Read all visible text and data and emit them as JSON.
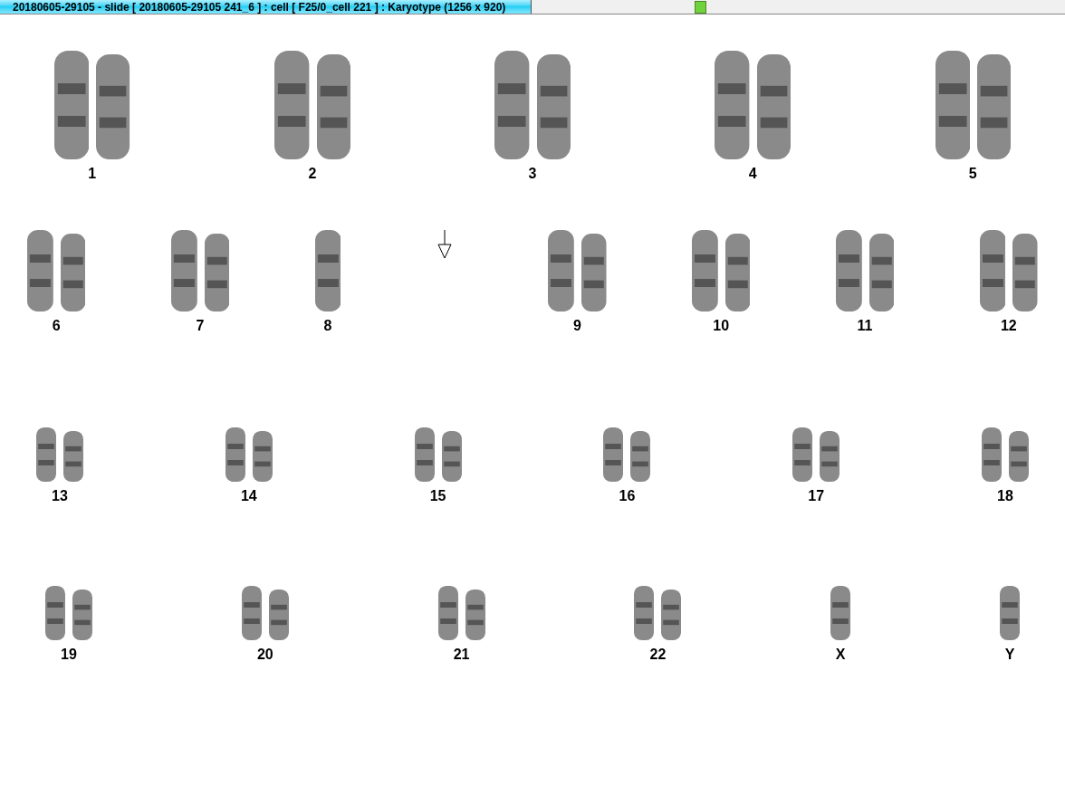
{
  "window": {
    "title": "20180605-29105 - slide [ 20180605-29105 241_6 ] : cell [ F25/0_cell 221 ] : Karyotype  (1256 x 920)"
  },
  "karyotype": {
    "rows": [
      [
        {
          "label": "1",
          "kind": "pair"
        },
        {
          "label": "2",
          "kind": "pair"
        },
        {
          "label": "3",
          "kind": "pair"
        },
        {
          "label": "4",
          "kind": "pair"
        },
        {
          "label": "5",
          "kind": "pair"
        }
      ],
      [
        {
          "label": "6",
          "kind": "pair"
        },
        {
          "label": "7",
          "kind": "pair"
        },
        {
          "label": "8",
          "kind": "single"
        },
        {
          "kind": "marker"
        },
        {
          "label": "9",
          "kind": "pair"
        },
        {
          "label": "10",
          "kind": "pair"
        },
        {
          "label": "11",
          "kind": "pair"
        },
        {
          "label": "12",
          "kind": "pair"
        }
      ],
      [
        {
          "label": "13",
          "kind": "pair"
        },
        {
          "label": "14",
          "kind": "pair"
        },
        {
          "label": "15",
          "kind": "pair"
        },
        {
          "label": "16",
          "kind": "pair"
        },
        {
          "label": "17",
          "kind": "pair"
        },
        {
          "label": "18",
          "kind": "pair"
        }
      ],
      [
        {
          "label": "19",
          "kind": "pair"
        },
        {
          "label": "20",
          "kind": "pair"
        },
        {
          "label": "21",
          "kind": "pair"
        },
        {
          "label": "22",
          "kind": "pair"
        },
        {
          "label": "X",
          "kind": "single"
        },
        {
          "label": "Y",
          "kind": "single"
        }
      ]
    ]
  }
}
